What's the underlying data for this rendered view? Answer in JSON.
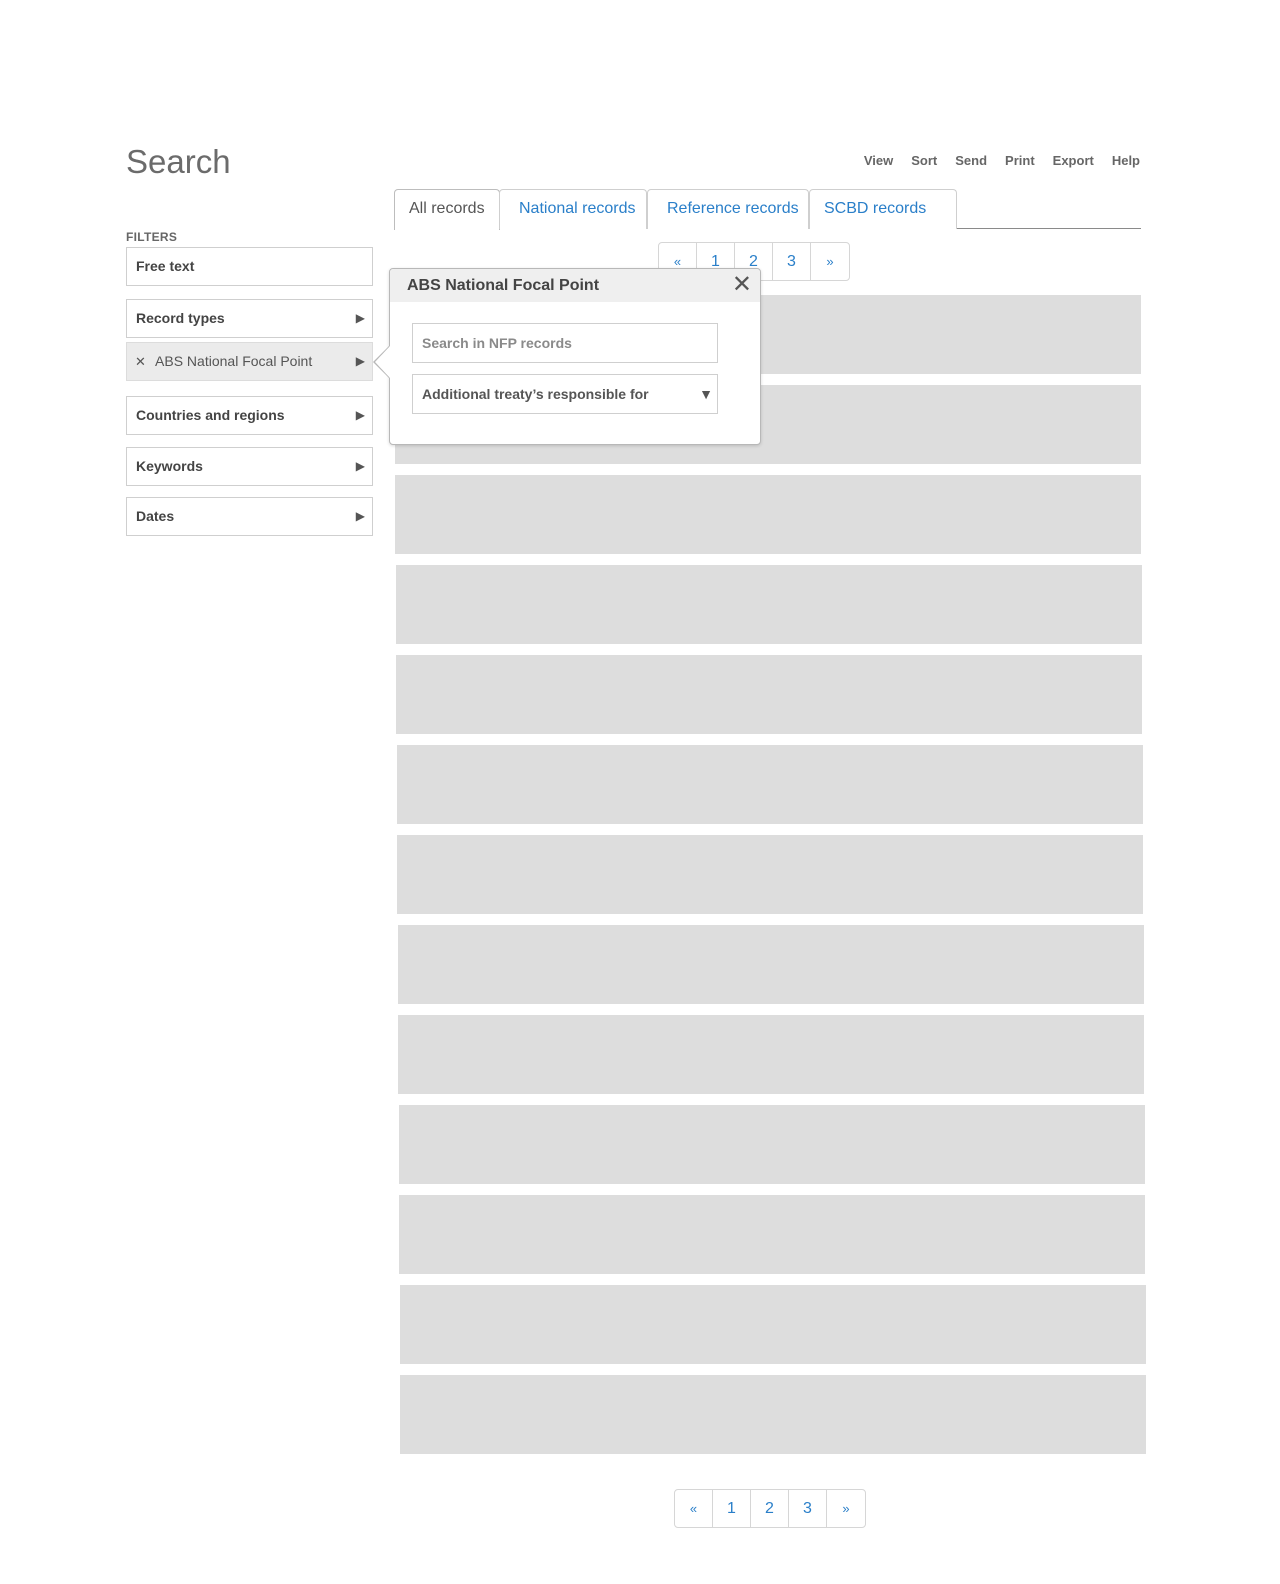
{
  "header": {
    "title": "Search"
  },
  "toolbar": {
    "items": [
      "View",
      "Sort",
      "Send",
      "Print",
      "Export",
      "Help"
    ]
  },
  "tabs": [
    {
      "label": "All records",
      "active": true
    },
    {
      "label": "National records",
      "active": false
    },
    {
      "label": "Reference records",
      "active": false
    },
    {
      "label": "SCBD records",
      "active": false
    }
  ],
  "filters": {
    "heading": "FILTERS",
    "free_text": "Free text",
    "record_types": "Record types",
    "selected_record_type": "ABS National Focal Point",
    "countries": "Countries and regions",
    "keywords": "Keywords",
    "dates": "Dates",
    "remove_glyph": "✕",
    "expand_glyph": "▶"
  },
  "pagination": {
    "prev": "«",
    "pages": [
      "1",
      "2",
      "3"
    ],
    "next": "»"
  },
  "popover": {
    "title": "ABS National Focal Point",
    "close_glyph": "✕",
    "search_placeholder": "Search in NFP records",
    "select_value": "Additional treaty’s responsible for",
    "select_caret": "▼"
  },
  "colors": {
    "link": "#2a7fc9",
    "placeholder_row": "#dddddd",
    "selected_filter_bg": "#ebebeb"
  }
}
